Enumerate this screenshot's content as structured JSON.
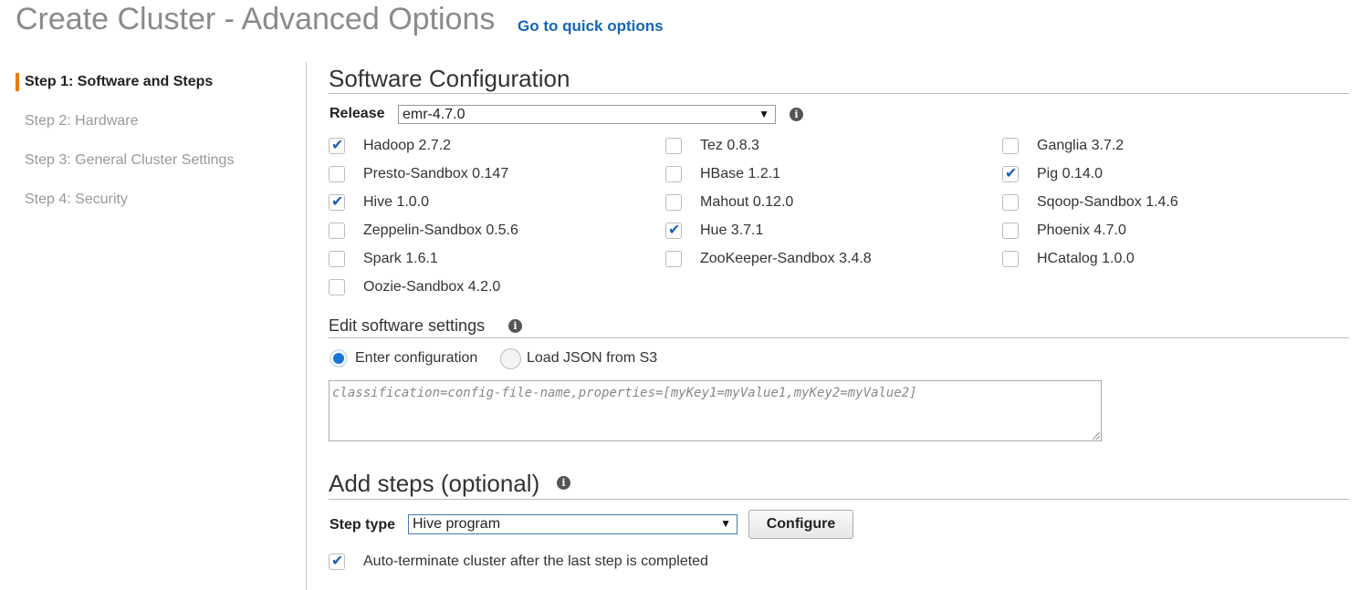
{
  "header": {
    "title": "Create Cluster - Advanced Options",
    "quick_link": "Go to quick options"
  },
  "steps_nav": [
    {
      "label": "Step 1: Software and Steps",
      "active": true
    },
    {
      "label": "Step 2: Hardware",
      "active": false
    },
    {
      "label": "Step 3: General Cluster Settings",
      "active": false
    },
    {
      "label": "Step 4: Security",
      "active": false
    }
  ],
  "software": {
    "title": "Software Configuration",
    "release_label": "Release",
    "release_value": "emr-4.7.0",
    "applications": [
      {
        "name": "Hadoop 2.7.2",
        "checked": true
      },
      {
        "name": "Tez 0.8.3",
        "checked": false
      },
      {
        "name": "Ganglia 3.7.2",
        "checked": false
      },
      {
        "name": "Presto-Sandbox 0.147",
        "checked": false
      },
      {
        "name": "HBase 1.2.1",
        "checked": false
      },
      {
        "name": "Pig 0.14.0",
        "checked": true
      },
      {
        "name": "Hive 1.0.0",
        "checked": true
      },
      {
        "name": "Mahout 0.12.0",
        "checked": false
      },
      {
        "name": "Sqoop-Sandbox 1.4.6",
        "checked": false
      },
      {
        "name": "Zeppelin-Sandbox 0.5.6",
        "checked": false
      },
      {
        "name": "Hue 3.7.1",
        "checked": true
      },
      {
        "name": "Phoenix 4.7.0",
        "checked": false
      },
      {
        "name": "Spark 1.6.1",
        "checked": false
      },
      {
        "name": "ZooKeeper-Sandbox 3.4.8",
        "checked": false
      },
      {
        "name": "HCatalog 1.0.0",
        "checked": false
      },
      {
        "name": "Oozie-Sandbox 4.2.0",
        "checked": false
      }
    ]
  },
  "edit_settings": {
    "title": "Edit software settings",
    "option_enter": "Enter configuration",
    "option_load": "Load JSON from S3",
    "selected": "enter",
    "placeholder": "classification=config-file-name,properties=[myKey1=myValue1,myKey2=myValue2]"
  },
  "add_steps": {
    "title": "Add steps (optional)",
    "step_type_label": "Step type",
    "step_type_value": "Hive program",
    "configure_label": "Configure",
    "auto_terminate_label": "Auto-terminate cluster after the last step is completed",
    "auto_terminate_checked": true
  },
  "icons": {
    "info": "info-icon",
    "checkbox_tick": "check-icon",
    "dropdown": "chevron-down-icon"
  },
  "colors": {
    "accent": "#e87b00",
    "link": "#1166bb",
    "check": "#1a5fb4",
    "radio": "#1a73d8"
  }
}
